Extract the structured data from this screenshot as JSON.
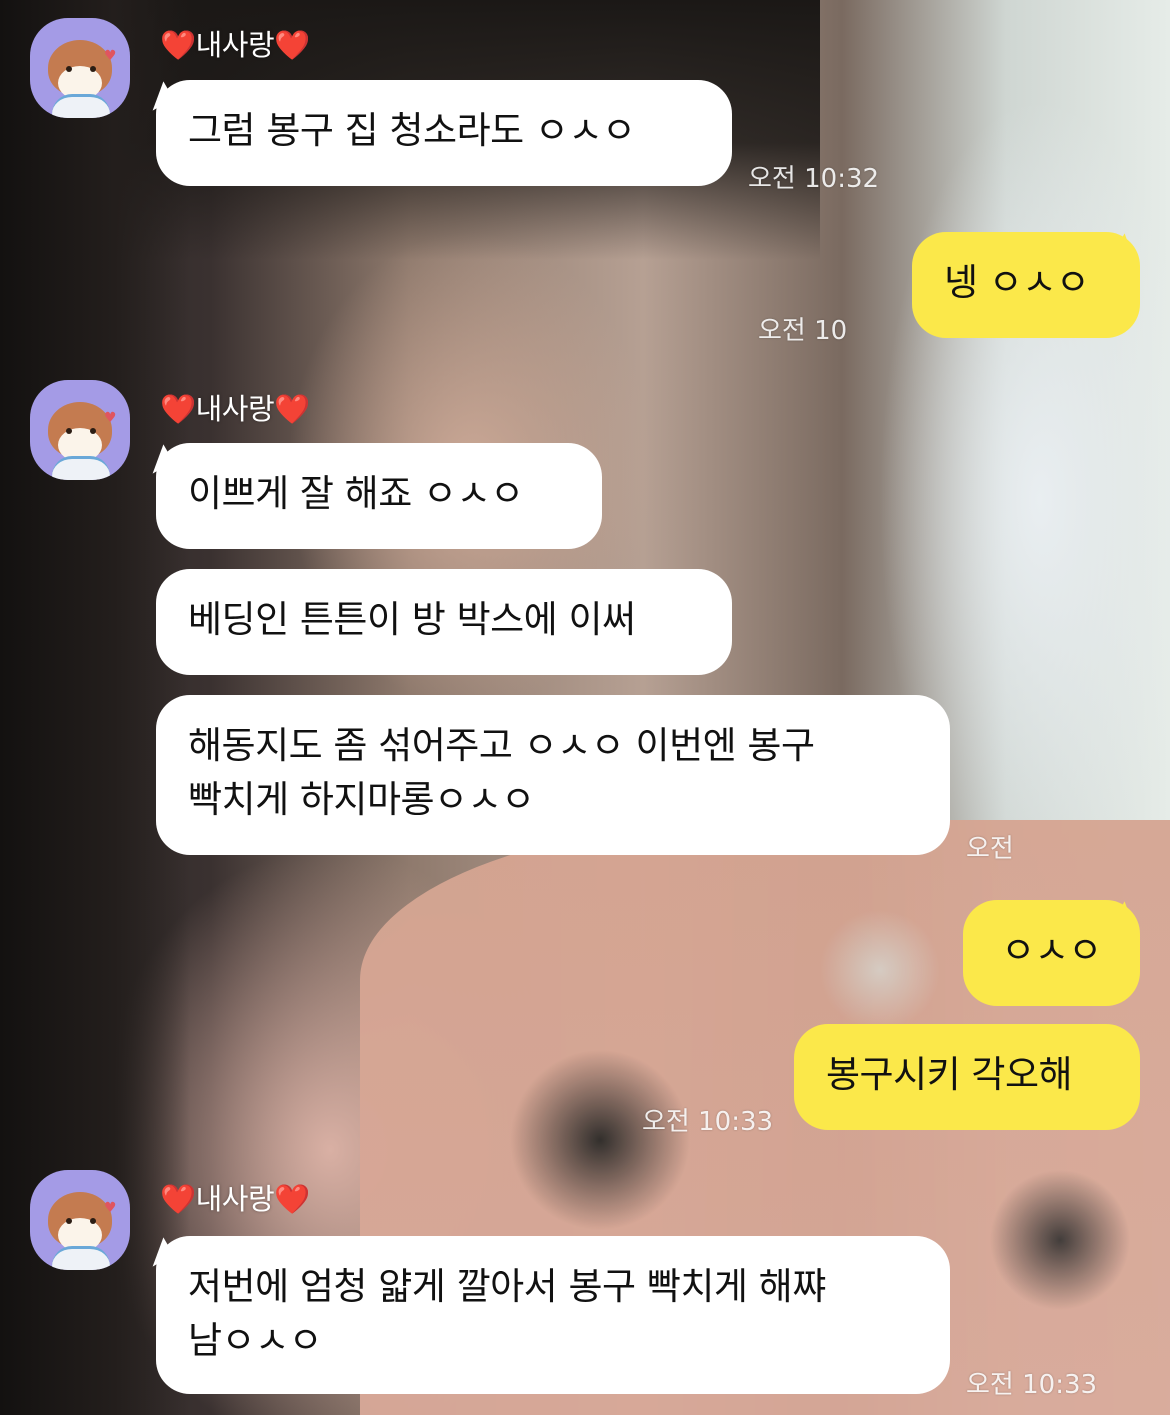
{
  "contact": {
    "name": "내사랑",
    "heart": "❤️"
  },
  "messages": {
    "m1": {
      "text": "그럼 봉구 집 청소라도 ㅇㅅㅇ",
      "time": "오전 10:32"
    },
    "m2": {
      "text": "넹 ㅇㅅㅇ",
      "time": "오전 10"
    },
    "m3": {
      "text": "이쁘게 잘 해죠 ㅇㅅㅇ"
    },
    "m4": {
      "text": "베딩인 튼튼이 방 박스에 이써"
    },
    "m5": {
      "text": "해동지도 좀 섞어주고 ㅇㅅㅇ 이번엔 봉구\n빡치게 하지마롱ㅇㅅㅇ",
      "time": "오전"
    },
    "m6": {
      "text": "ㅇㅅㅇ"
    },
    "m7": {
      "text": "봉구시키 각오해",
      "time": "오전 10:33"
    },
    "m8": {
      "text": "저번에 엄청 얇게 깔아서 봉구 빡치게 해쨔\n남ㅇㅅㅇ",
      "time": "오전 10:33"
    }
  },
  "colors": {
    "my_bubble": "#fbe84a",
    "their_bubble": "#ffffff",
    "name_heart": "#e3252f",
    "avatar_bg": "#a49be6"
  },
  "icons": {
    "avatar": "hamster-avatar-icon",
    "heart": "red-heart-icon"
  }
}
